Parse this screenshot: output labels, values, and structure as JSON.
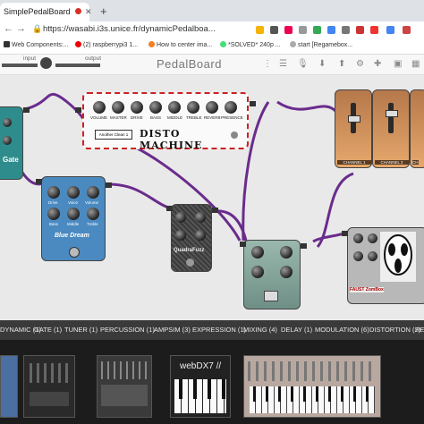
{
  "browser": {
    "tab_title": "SimplePedalBoard",
    "url": "https://wasabi.i3s.unice.fr/dynamicPedalboa...",
    "bookmarks": [
      "Web Components:...",
      "(2) raspberrypi3 1...",
      "How to center ima...",
      "*SOLVED* 240p ...",
      "start [Regamebox..."
    ]
  },
  "app": {
    "input_label": "input",
    "output_label": "output",
    "title": "PedalBoard"
  },
  "pedals": {
    "disto": {
      "name": "DISTO MACHINE",
      "knob_labels": [
        "VOLUME",
        "MASTER",
        "DRIVE",
        "BASS",
        "MIDDLE",
        "TREBLE",
        "REVERB",
        "PRESENCE"
      ],
      "preset": "Another Clean 1"
    },
    "gate": {
      "name": "Gate"
    },
    "blue_dream": {
      "name": "Blue Dream",
      "knob_labels": [
        "Drive",
        "Voice",
        "Volume",
        "Bass",
        "Middle",
        "Treble"
      ]
    },
    "quadrafuzz": {
      "name": "QuadraFuzz"
    },
    "channels": [
      "CHANNEL 1",
      "CHANNEL 2",
      "CH"
    ],
    "fuzz_right": {
      "name": "FAUST ZomBox"
    }
  },
  "categories": [
    "DYNAMIC (1)",
    "GATE (1)",
    "TUNER (1)",
    "PERCUSSION (1)",
    "AMPSIM (3)",
    "EXPRESSION (1)",
    "MIXING (4)",
    "DELAY (1)",
    "MODULATION (6)",
    "DISTORTION (2)",
    "REVE"
  ],
  "shelf": {
    "webdx7": "webDX7 //"
  },
  "colors": {
    "cable": "#6a2c8c",
    "blue_pedal": "#4a8ac0",
    "teal_pedal": "#2e8c8c",
    "orange_strip": "#d9965a"
  }
}
